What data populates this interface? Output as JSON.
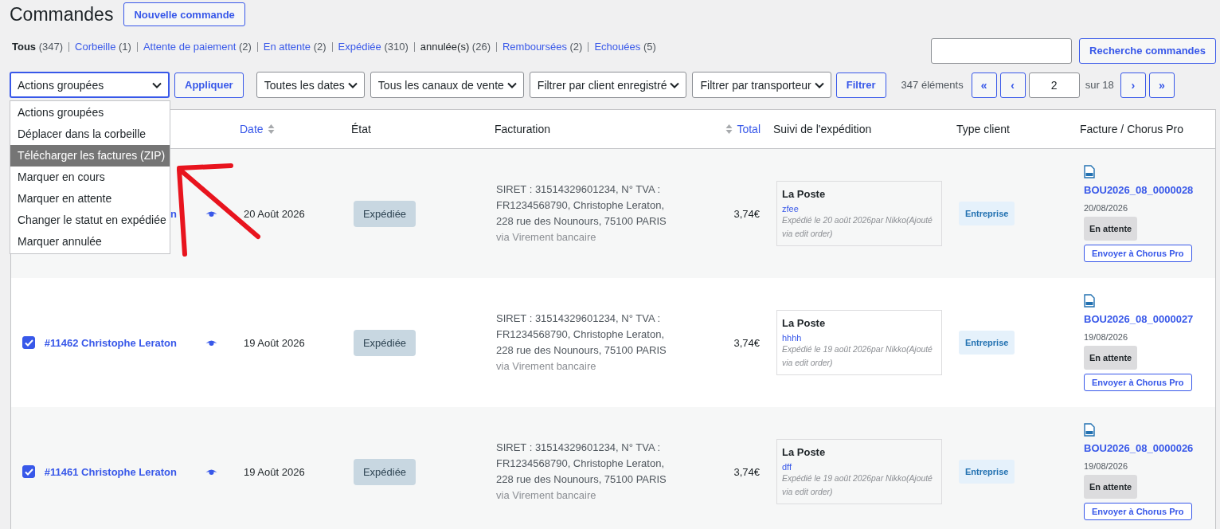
{
  "page": {
    "title": "Commandes",
    "new_button": "Nouvelle commande"
  },
  "status_filters": [
    {
      "label": "Tous",
      "count": "(347)",
      "kind": "current"
    },
    {
      "label": "Corbeille",
      "count": "(1)",
      "kind": "link"
    },
    {
      "label": "Attente de paiement",
      "count": "(2)",
      "kind": "link"
    },
    {
      "label": "En attente",
      "count": "(2)",
      "kind": "link"
    },
    {
      "label": "Expédiée",
      "count": "(310)",
      "kind": "link"
    },
    {
      "label": "annulée(s)",
      "count": "(26)",
      "kind": "plain"
    },
    {
      "label": "Remboursées",
      "count": "(2)",
      "kind": "link"
    },
    {
      "label": "Echouées",
      "count": "(5)",
      "kind": "link"
    }
  ],
  "search": {
    "button": "Recherche commandes"
  },
  "bulk_actions": {
    "value": "Actions groupées",
    "apply": "Appliquer",
    "options": [
      {
        "label": "Actions groupées",
        "highlighted": false
      },
      {
        "label": "Déplacer dans la corbeille",
        "highlighted": false
      },
      {
        "label": "Télécharger les factures (ZIP)",
        "highlighted": true
      },
      {
        "label": "Marquer en cours",
        "highlighted": false
      },
      {
        "label": "Marquer en attente",
        "highlighted": false
      },
      {
        "label": "Changer le statut en expédiée",
        "highlighted": false
      },
      {
        "label": "Marquer annulée",
        "highlighted": false
      }
    ]
  },
  "filters": [
    {
      "value": "Toutes les dates"
    },
    {
      "value": "Tous les canaux de vente"
    },
    {
      "value": "Filtrer par client enregistré"
    },
    {
      "value": "Filtrer par transporteur"
    }
  ],
  "filter_button": "Filtrer",
  "pagination": {
    "count": "347 éléments",
    "first": "«",
    "prev": "‹",
    "page": "2",
    "of": "sur 18",
    "next": "›",
    "last": "»"
  },
  "table": {
    "columns": [
      {
        "label": "Date",
        "sortable": true,
        "kind": "text"
      },
      {
        "label": "État",
        "sortable": false,
        "kind": "text"
      },
      {
        "label": "Facturation",
        "sortable": false,
        "kind": "text"
      },
      {
        "label": "Total",
        "sortable": true,
        "kind": "numeric"
      },
      {
        "label": "Suivi de l'expédition",
        "sortable": false,
        "kind": "text"
      },
      {
        "label": "Type client",
        "sortable": false,
        "kind": "text"
      },
      {
        "label": "Facture / Chorus Pro",
        "sortable": false,
        "kind": "text"
      }
    ],
    "rows": [
      {
        "order": "n",
        "date": "20 Août 2026",
        "status": "Expédiée",
        "billing": "SIRET : 31514329601234, N° TVA : FR1234568790, Christophe Leraton, 228 rue des Nounours, 75100 PARIS",
        "payment": "via Virement bancaire",
        "total": "3,74€",
        "shipping": {
          "carrier": "La Poste",
          "tracking": "zfee",
          "note": "Expédié le 20 août 2026par Nikko(Ajouté via edit order)"
        },
        "client_type": "Entreprise",
        "invoice": {
          "number": "BOU2026_08_0000028",
          "date": "20/08/2026",
          "status": "En attente",
          "button": "Envoyer à Chorus Pro"
        }
      },
      {
        "checked": true,
        "order": "#11462 Christophe Leraton",
        "date": "19 Août 2026",
        "status": "Expédiée",
        "billing": "SIRET : 31514329601234, N° TVA : FR1234568790, Christophe Leraton, 228 rue des Nounours, 75100 PARIS",
        "payment": "via Virement bancaire",
        "total": "3,74€",
        "shipping": {
          "carrier": "La Poste",
          "tracking": "hhhh",
          "note": "Expédié le 19 août 2026par Nikko(Ajouté via edit order)"
        },
        "client_type": "Entreprise",
        "invoice": {
          "number": "BOU2026_08_0000027",
          "date": "19/08/2026",
          "status": "En attente",
          "button": "Envoyer à Chorus Pro"
        }
      },
      {
        "checked": true,
        "order": "#11461 Christophe Leraton",
        "date": "19 Août 2026",
        "status": "Expédiée",
        "billing": "SIRET : 31514329601234, N° TVA : FR1234568790, Christophe Leraton, 228 rue des Nounours, 75100 PARIS",
        "payment": "via Virement bancaire",
        "total": "3,74€",
        "shipping": {
          "carrier": "La Poste",
          "tracking": "dff",
          "note": "Expédié le 19 août 2026par Nikko(Ajouté via edit order)"
        },
        "client_type": "Entreprise",
        "invoice": {
          "number": "BOU2026_08_0000026",
          "date": "19/08/2026",
          "status": "En attente",
          "button": "Envoyer à Chorus Pro"
        }
      }
    ]
  }
}
